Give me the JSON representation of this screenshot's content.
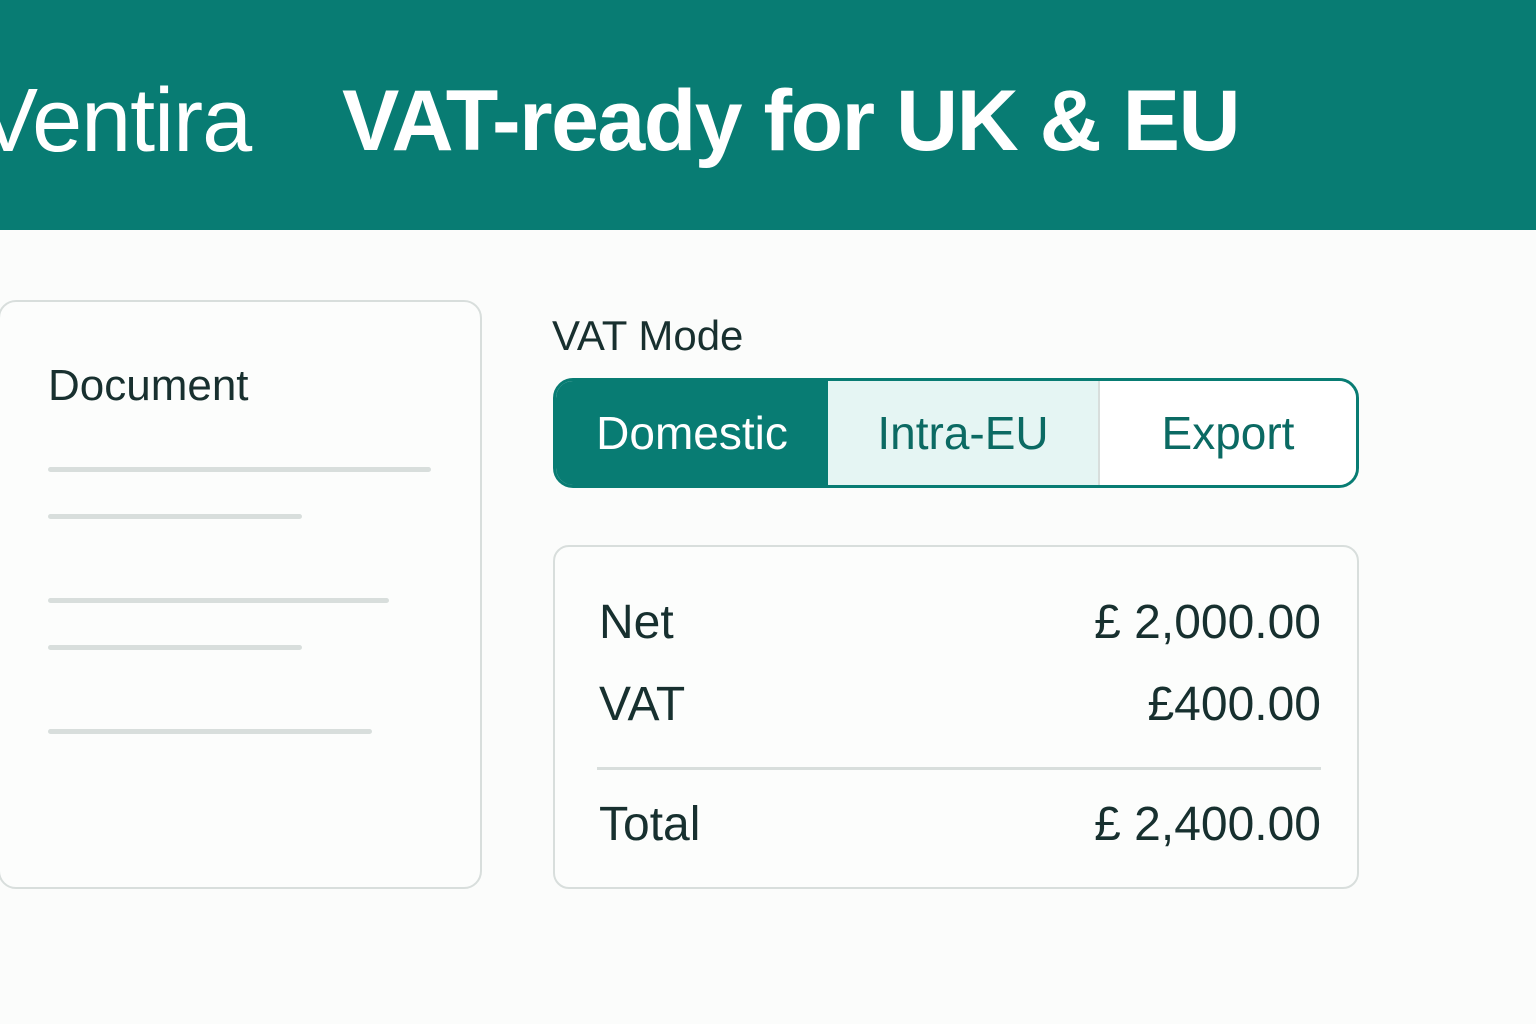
{
  "header": {
    "brand": "Ventira",
    "headline": "VAT-ready for UK & EU"
  },
  "document_card": {
    "title": "Document"
  },
  "vat_mode": {
    "label": "VAT Mode",
    "options": [
      "Domestic",
      "Intra-EU",
      "Export"
    ],
    "selected": "Domestic"
  },
  "summary": {
    "rows": [
      {
        "label": "Net",
        "value": "£ 2,000.00"
      },
      {
        "label": "VAT",
        "value": "£400.00"
      },
      {
        "label": "Total",
        "value": "£ 2,400.00"
      }
    ]
  },
  "colors": {
    "brand": "#087c73",
    "selected_bg": "#087c73",
    "intra_eu_bg": "#e5f5f3",
    "border": "#d8dedc",
    "text": "#17302f"
  }
}
